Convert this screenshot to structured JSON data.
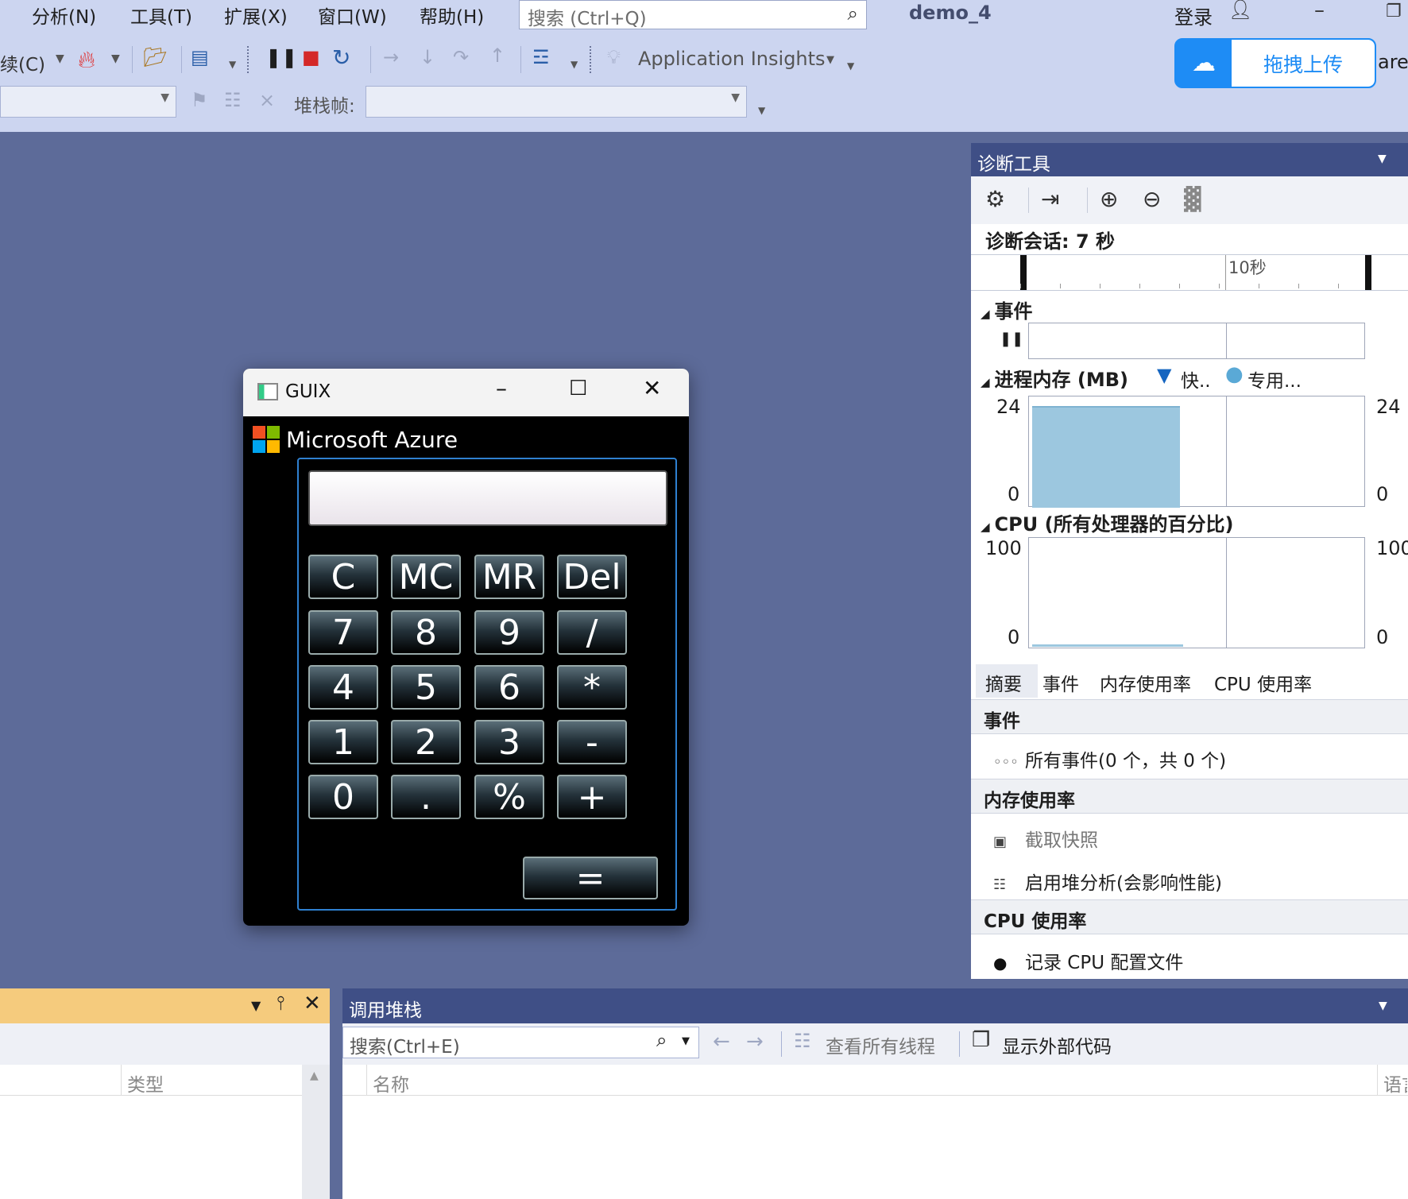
{
  "menu": {
    "items": [
      "分析(N)",
      "工具(T)",
      "扩展(X)",
      "窗口(W)",
      "帮助(H)"
    ],
    "search_placeholder": "搜索 (Ctrl+Q)",
    "project_name": "demo_4",
    "login": "登录"
  },
  "toolbar": {
    "continue_label": "续(C)",
    "app_insights": "Application Insights",
    "stack_frame_label": "堆栈帧:",
    "share_fragment": "are"
  },
  "cloud_upload": {
    "label": "拖拽上传",
    "accent": "#1e8cf5"
  },
  "calculator": {
    "title": "GUIX",
    "brand": "Microsoft Azure",
    "display_value": "",
    "buttons": [
      [
        "C",
        "MC",
        "MR",
        "Del"
      ],
      [
        "7",
        "8",
        "9",
        "/"
      ],
      [
        "4",
        "5",
        "6",
        "*"
      ],
      [
        "1",
        "2",
        "3",
        "-"
      ],
      [
        "0",
        ".",
        "%",
        "+"
      ]
    ],
    "equals": "="
  },
  "diagnostics": {
    "title": "诊断工具",
    "session": "诊断会话: 7 秒",
    "ruler_label": "10秒",
    "events_title": "事件",
    "memory_title": "进程内存 (MB)",
    "memory_legend_fast": "快..",
    "memory_legend_private": "专用...",
    "memory_axis_max": "24",
    "memory_axis_min": "0",
    "memory_fill_fraction": 0.45,
    "cpu_title": "CPU (所有处理器的百分比)",
    "cpu_axis_max": "100",
    "cpu_axis_min": "0",
    "tabs": [
      "摘要",
      "事件",
      "内存使用率",
      "CPU 使用率"
    ],
    "groups": {
      "events": "事件",
      "events_row": "所有事件(0 个，共 0 个)",
      "memory": "内存使用率",
      "snapshot": "截取快照",
      "heap": "启用堆分析(会影响性能)",
      "cpu": "CPU 使用率",
      "cpu_row": "记录 CPU 配置文件"
    }
  },
  "left_panel": {
    "col_type": "类型"
  },
  "callstack": {
    "title": "调用堆栈",
    "search_placeholder": "搜索(Ctrl+E)",
    "view_threads": "查看所有线程",
    "show_external": "显示外部代码",
    "col_name": "名称",
    "col_lang": "语言"
  }
}
